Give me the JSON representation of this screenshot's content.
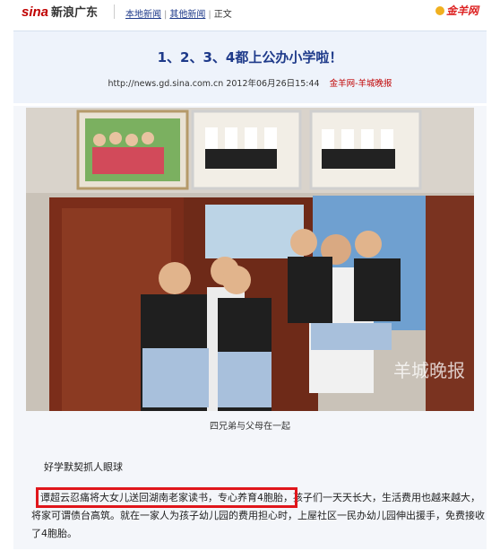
{
  "header": {
    "logo_text": "sina",
    "logo_cn": "新浪广东",
    "breadcrumbs": [
      "本地新闻",
      "其他新闻",
      "正文"
    ],
    "brand": "金羊网"
  },
  "article": {
    "title": "1、2、3、4都上公办小学啦！",
    "url": "http://news.gd.sina.com.cn",
    "datetime": "2012年06月26日15:44",
    "source": "金羊网-羊城晚报",
    "photo_caption": "四兄弟与父母在一起",
    "photo_watermark": "羊城晚报",
    "subheading": "好学默契抓人眼球",
    "highlight_text": "谭超云忍痛将大女儿送回湖南老家读书，专心养育4胞胎，",
    "paragraph_rest": "孩子们一天天长大，生活费用也越来越大，将家可谓债台高筑。就在一家人为孩子幼儿园的费用担心时，上屋社区一民办幼儿园伸出援手，免费接收了4胞胎。"
  },
  "colors": {
    "link": "#1e3a8a",
    "accent_red": "#e0161b",
    "header_bg": "#eef3fb"
  }
}
